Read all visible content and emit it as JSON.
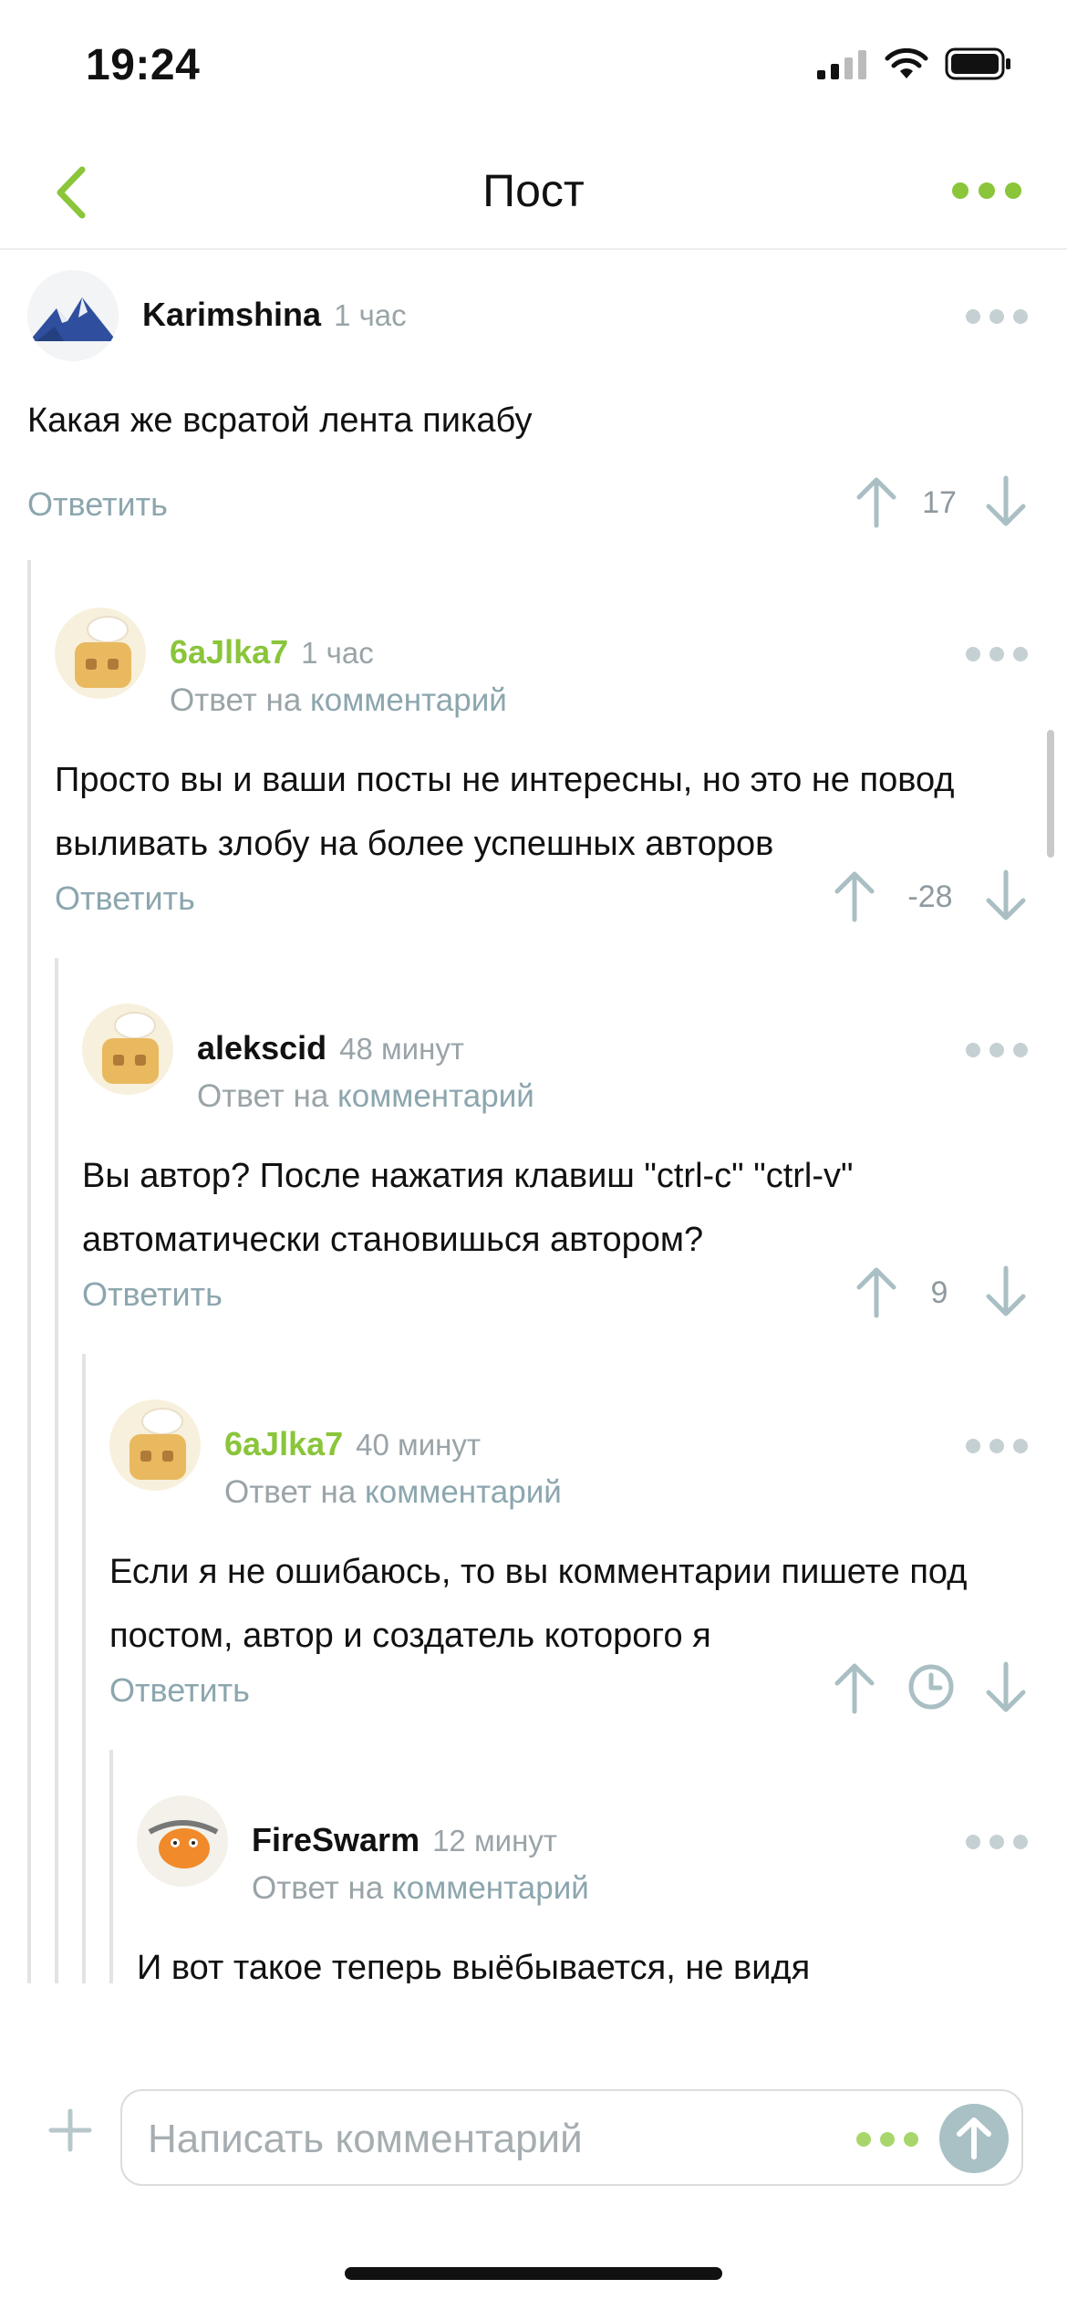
{
  "status": {
    "time": "19:24"
  },
  "header": {
    "title": "Пост"
  },
  "comments": [
    {
      "author": "Karimshina",
      "time": "1 час",
      "reply_prefix": "",
      "reply_link": "",
      "text": "Какая же всратой лента пикабу",
      "reply": "Ответить",
      "rating": "17",
      "avatar": "mountain-avatar"
    },
    {
      "author": "6aJlka7",
      "time": "1 час",
      "reply_prefix": "Ответ на",
      "reply_link": "комментарий",
      "text": "Просто вы и ваши посты не интересны, но это не повод выливать злобу на более успешных авторов",
      "reply": "Ответить",
      "rating": "-28",
      "avatar": "toaster-chef-avatar"
    },
    {
      "author": "alekscid",
      "time": "48 минут",
      "reply_prefix": "Ответ на",
      "reply_link": "комментарий",
      "text": "Вы автор? После нажатия клавиш \"ctrl-c\" \"ctrl-v\" автоматически становишься автором?",
      "reply": "Ответить",
      "rating": "9",
      "avatar": "toaster-chef-avatar"
    },
    {
      "author": "6aJlka7",
      "time": "40 минут",
      "reply_prefix": "Ответ на",
      "reply_link": "комментарий",
      "text": "Если я не ошибаюсь, то вы комментарии пишете под постом, автор и создатель которого я",
      "reply": "Ответить",
      "rating": "",
      "avatar": "toaster-chef-avatar"
    },
    {
      "author": "FireSwarm",
      "time": "12 минут",
      "reply_prefix": "Ответ на",
      "reply_link": "комментарий",
      "text": "И вот такое теперь выёбывается, не видя",
      "reply": "",
      "rating": "",
      "avatar": "orange-creature-avatar"
    }
  ],
  "composer": {
    "placeholder": "Написать комментарий"
  },
  "colors": {
    "accent": "#8ac53a",
    "muted": "#8ca6ae",
    "gray": "#9aa4a8"
  }
}
